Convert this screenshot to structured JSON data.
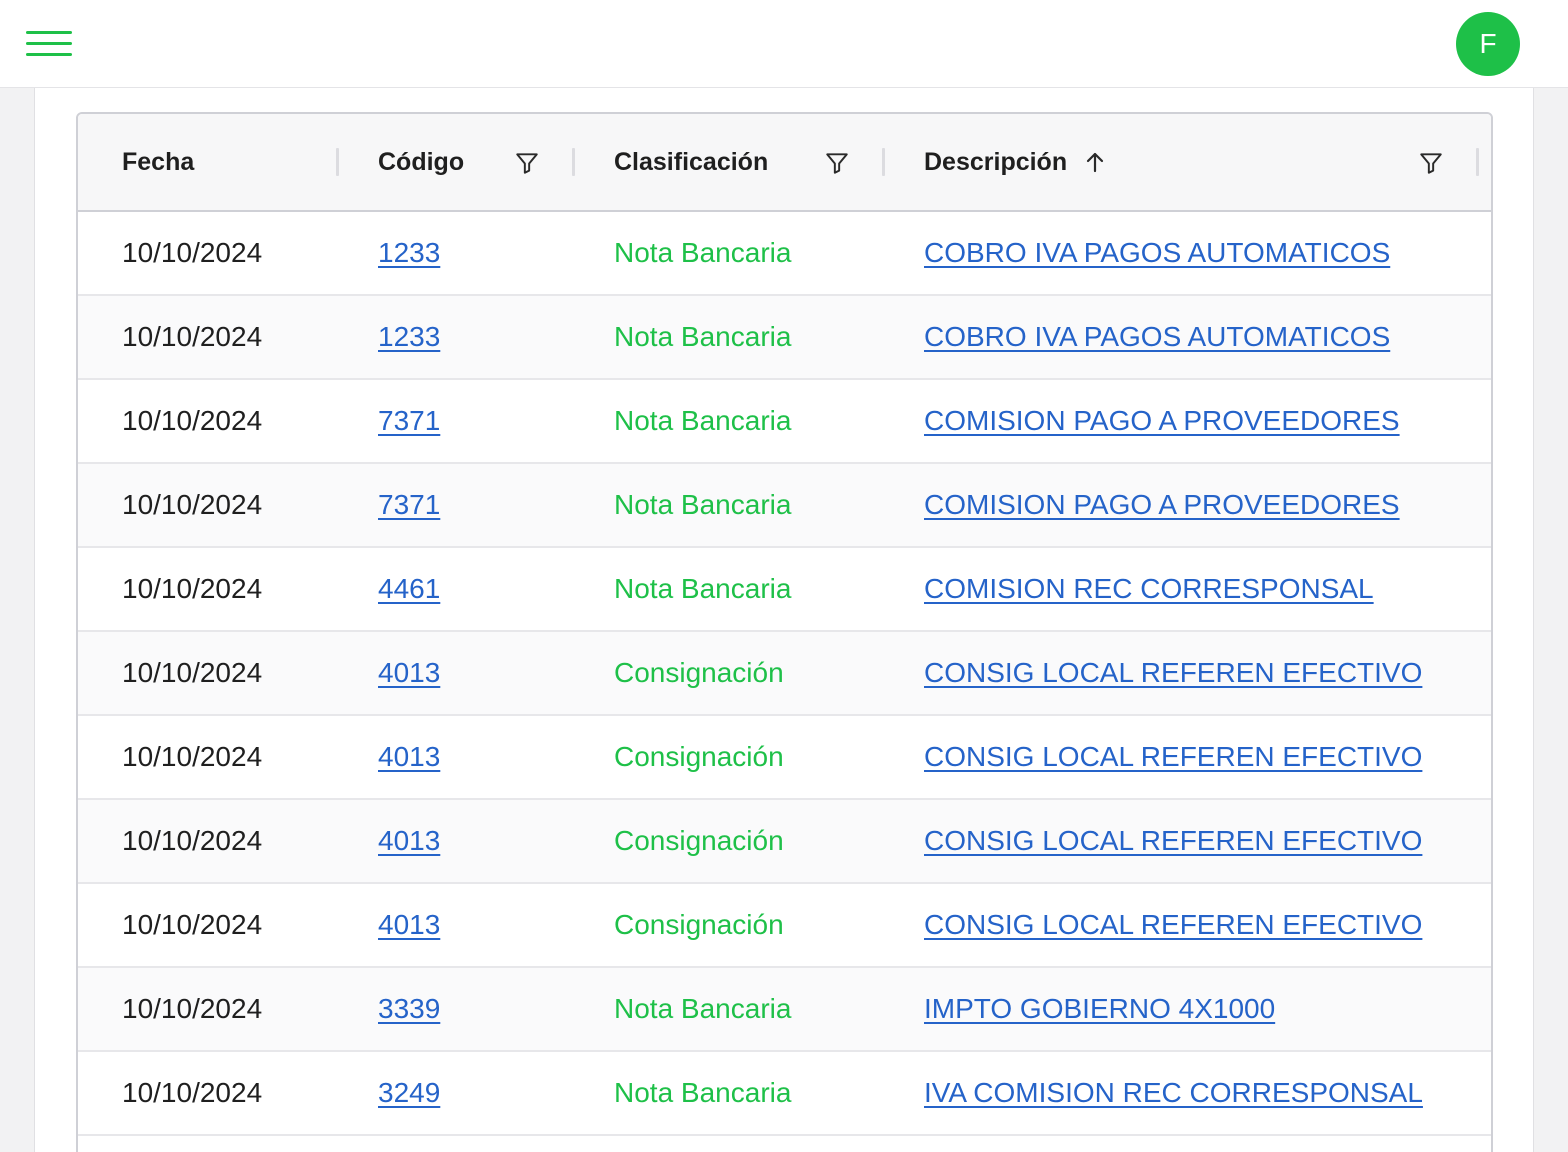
{
  "header": {
    "avatar_initial": "F",
    "menu_icon": "hamburger-menu-icon"
  },
  "colors": {
    "accent": "#1ec048",
    "link": "#2563c9"
  },
  "table": {
    "columns": {
      "fecha": "Fecha",
      "codigo": "Código",
      "clasificacion": "Clasificación",
      "descripcion": "Descripción"
    },
    "sort": {
      "column": "descripcion",
      "direction": "ascending"
    },
    "rows": [
      {
        "fecha": "10/10/2024",
        "codigo": "1233",
        "clasificacion": "Nota Bancaria",
        "descripcion": "COBRO IVA PAGOS AUTOMATICOS"
      },
      {
        "fecha": "10/10/2024",
        "codigo": "1233",
        "clasificacion": "Nota Bancaria",
        "descripcion": "COBRO IVA PAGOS AUTOMATICOS"
      },
      {
        "fecha": "10/10/2024",
        "codigo": "7371",
        "clasificacion": "Nota Bancaria",
        "descripcion": "COMISION PAGO A PROVEEDORES"
      },
      {
        "fecha": "10/10/2024",
        "codigo": "7371",
        "clasificacion": "Nota Bancaria",
        "descripcion": "COMISION PAGO A PROVEEDORES"
      },
      {
        "fecha": "10/10/2024",
        "codigo": "4461",
        "clasificacion": "Nota Bancaria",
        "descripcion": "COMISION REC CORRESPONSAL"
      },
      {
        "fecha": "10/10/2024",
        "codigo": "4013",
        "clasificacion": "Consignación",
        "descripcion": "CONSIG LOCAL REFEREN EFECTIVO"
      },
      {
        "fecha": "10/10/2024",
        "codigo": "4013",
        "clasificacion": "Consignación",
        "descripcion": "CONSIG LOCAL REFEREN EFECTIVO"
      },
      {
        "fecha": "10/10/2024",
        "codigo": "4013",
        "clasificacion": "Consignación",
        "descripcion": "CONSIG LOCAL REFEREN EFECTIVO"
      },
      {
        "fecha": "10/10/2024",
        "codigo": "4013",
        "clasificacion": "Consignación",
        "descripcion": "CONSIG LOCAL REFEREN EFECTIVO"
      },
      {
        "fecha": "10/10/2024",
        "codigo": "3339",
        "clasificacion": "Nota Bancaria",
        "descripcion": "IMPTO GOBIERNO 4X1000"
      },
      {
        "fecha": "10/10/2024",
        "codigo": "3249",
        "clasificacion": "Nota Bancaria",
        "descripcion": "IVA COMISION REC CORRESPONSAL"
      }
    ]
  }
}
